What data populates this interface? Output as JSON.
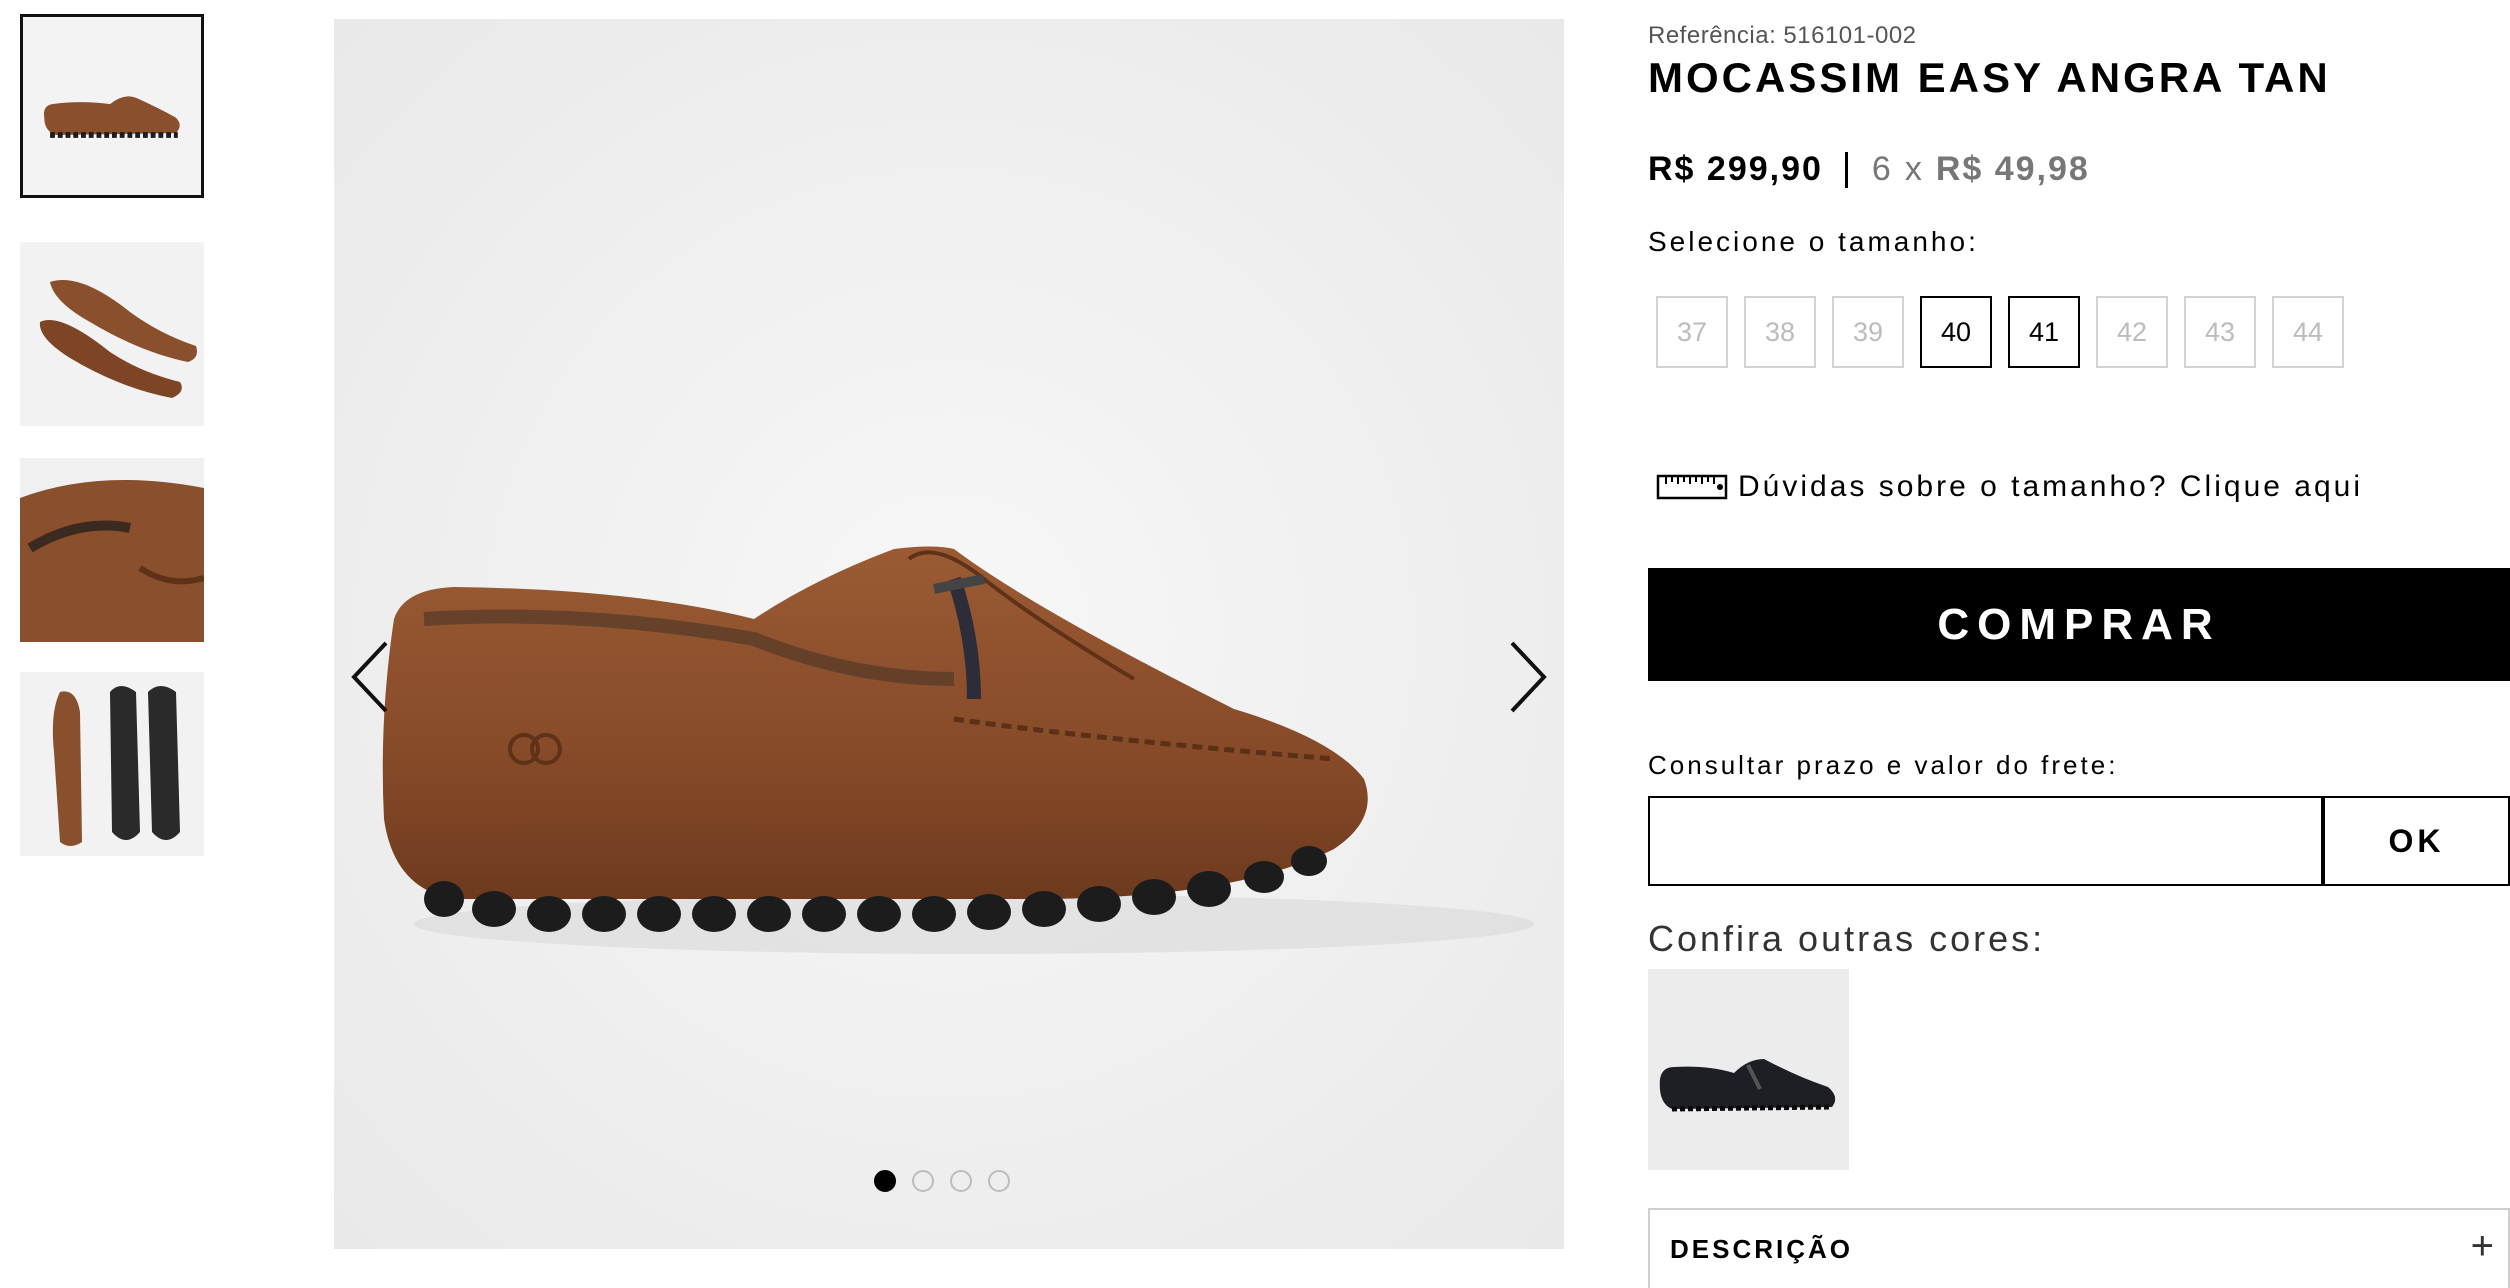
{
  "gallery": {
    "thumbnails": [
      {
        "alt": "thumbnail-side-view",
        "active": true
      },
      {
        "alt": "thumbnail-pair-view",
        "active": false
      },
      {
        "alt": "thumbnail-detail-view",
        "active": false
      },
      {
        "alt": "thumbnail-sole-view",
        "active": false
      }
    ],
    "dots": 4,
    "active_dot": 0
  },
  "product": {
    "reference": "Referência: 516101-002",
    "title": "MOCASSIM EASY ANGRA TAN",
    "price": "R$ 299,90",
    "installments_count": "6",
    "installments_x": "x",
    "installment_value": "R$ 49,98",
    "size_label": "Selecione o tamanho:",
    "sizes": [
      {
        "label": "37",
        "available": false
      },
      {
        "label": "38",
        "available": false
      },
      {
        "label": "39",
        "available": false
      },
      {
        "label": "40",
        "available": true
      },
      {
        "label": "41",
        "available": true
      },
      {
        "label": "42",
        "available": false
      },
      {
        "label": "43",
        "available": false
      },
      {
        "label": "44",
        "available": false
      }
    ],
    "size_help": "Dúvidas sobre o tamanho? Clique aqui",
    "buy_label": "COMPRAR",
    "freight_label": "Consultar prazo e valor do frete:",
    "freight_input_value": "",
    "freight_button": "OK",
    "other_colors_label": "Confira outras cores:",
    "description_label": "DESCRIÇÃO",
    "description_toggle": "+"
  },
  "colors": {
    "leather": "#8a4f2c",
    "leather_dark": "#5e3218",
    "sole": "#1c1c1c",
    "buy_bg": "#000000"
  }
}
